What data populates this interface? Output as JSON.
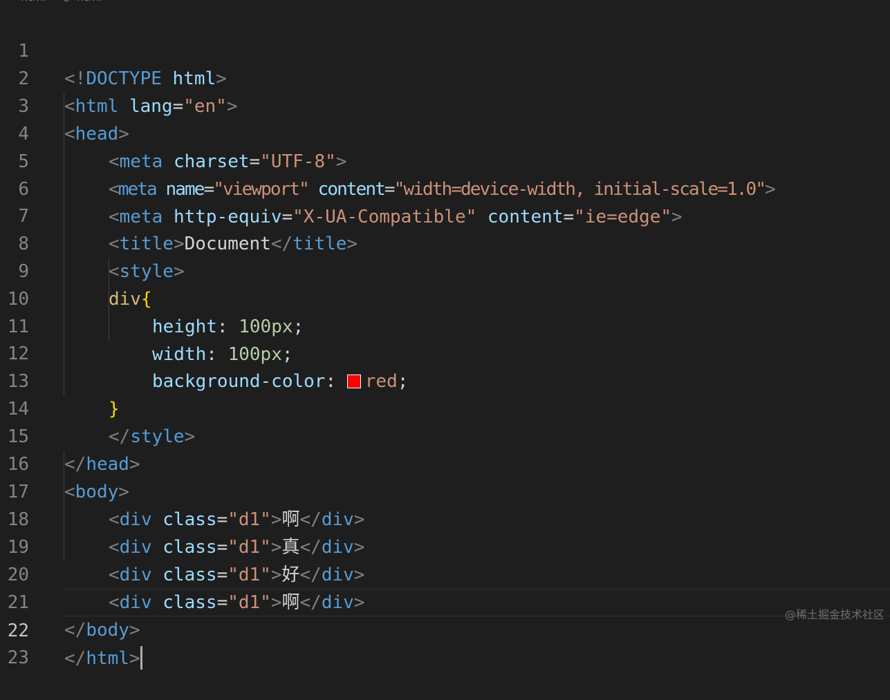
{
  "breadcrumb": {
    "file": "html",
    "symbol": "html"
  },
  "lines": {
    "n1": "1",
    "n2": "2",
    "n3": "3",
    "n4": "4",
    "n5": "5",
    "n6": "6",
    "n7": "7",
    "n8": "8",
    "n9": "9",
    "n10": "10",
    "n11": "11",
    "n12": "12",
    "n13": "13",
    "n14": "14",
    "n15": "15",
    "n16": "16",
    "n17": "17",
    "n18": "18",
    "n19": "19",
    "n20": "20",
    "n21": "21",
    "n22": "22",
    "n23": "23"
  },
  "code": {
    "l1": {
      "open": "<!",
      "tag": "DOCTYPE",
      "attr": "html",
      "close": ">"
    },
    "l2": {
      "open": "<",
      "tag": "html",
      "attr": "lang",
      "eq": "=",
      "val": "\"en\"",
      "close": ">"
    },
    "l3": {
      "open": "<",
      "tag": "head",
      "close": ">"
    },
    "l4": {
      "open": "<",
      "tag": "meta",
      "attr": "charset",
      "eq": "=",
      "val": "\"UTF-8\"",
      "close": ">"
    },
    "l5": {
      "open": "<",
      "tag": "meta",
      "attr1": "name",
      "eq1": "=",
      "val1": "\"viewport\"",
      "attr2": "content",
      "eq2": "=",
      "val2": "\"width=device-width, initial-scale=1.0\"",
      "close": ">"
    },
    "l6": {
      "open": "<",
      "tag": "meta",
      "attr1": "http-equiv",
      "eq1": "=",
      "val1": "\"X-UA-Compatible\"",
      "attr2": "content",
      "eq2": "=",
      "val2": "\"ie=edge\"",
      "close": ">"
    },
    "l7": {
      "open": "<",
      "tag": "title",
      "close": ">",
      "text": "Document",
      "end_open": "</",
      "end_tag": "title",
      "end_close": ">"
    },
    "l8": {
      "open": "<",
      "tag": "style",
      "close": ">"
    },
    "l9": {
      "selector": "div",
      "brace": "{"
    },
    "l10": {
      "prop": "height",
      "colon": ":",
      "value": "100px",
      "semi": ";"
    },
    "l11": {
      "prop": "width",
      "colon": ":",
      "value": "100px",
      "semi": ";"
    },
    "l12": {
      "prop": "background-color",
      "colon": ":",
      "value": "red",
      "semi": ";",
      "swatch_color": "#ff0000"
    },
    "l13": {
      "brace": "}"
    },
    "l14": {
      "open": "</",
      "tag": "style",
      "close": ">"
    },
    "l15": {
      "open": "</",
      "tag": "head",
      "close": ">"
    },
    "l16": {
      "open": "<",
      "tag": "body",
      "close": ">"
    },
    "l17": {
      "open": "<",
      "tag": "div",
      "attr": "class",
      "eq": "=",
      "val": "\"d1\"",
      "close": ">",
      "text": "啊",
      "end_open": "</",
      "end_tag": "div",
      "end_close": ">"
    },
    "l18": {
      "open": "<",
      "tag": "div",
      "attr": "class",
      "eq": "=",
      "val": "\"d1\"",
      "close": ">",
      "text": "真",
      "end_open": "</",
      "end_tag": "div",
      "end_close": ">"
    },
    "l19": {
      "open": "<",
      "tag": "div",
      "attr": "class",
      "eq": "=",
      "val": "\"d1\"",
      "close": ">",
      "text": "好",
      "end_open": "</",
      "end_tag": "div",
      "end_close": ">"
    },
    "l20": {
      "open": "<",
      "tag": "div",
      "attr": "class",
      "eq": "=",
      "val": "\"d1\"",
      "close": ">",
      "text": "啊",
      "end_open": "</",
      "end_tag": "div",
      "end_close": ">"
    },
    "l21": {
      "open": "</",
      "tag": "body",
      "close": ">"
    },
    "l22": {
      "open": "</",
      "tag": "html",
      "close": ">"
    }
  },
  "watermark": "@稀土掘金技术社区",
  "colors": {
    "background": "#1e1e1e",
    "tag": "#569cd6",
    "attribute": "#9cdcfe",
    "string": "#ce9178",
    "number": "#b5cea8",
    "selector": "#d7ba7d",
    "brace": "#ffd700"
  }
}
